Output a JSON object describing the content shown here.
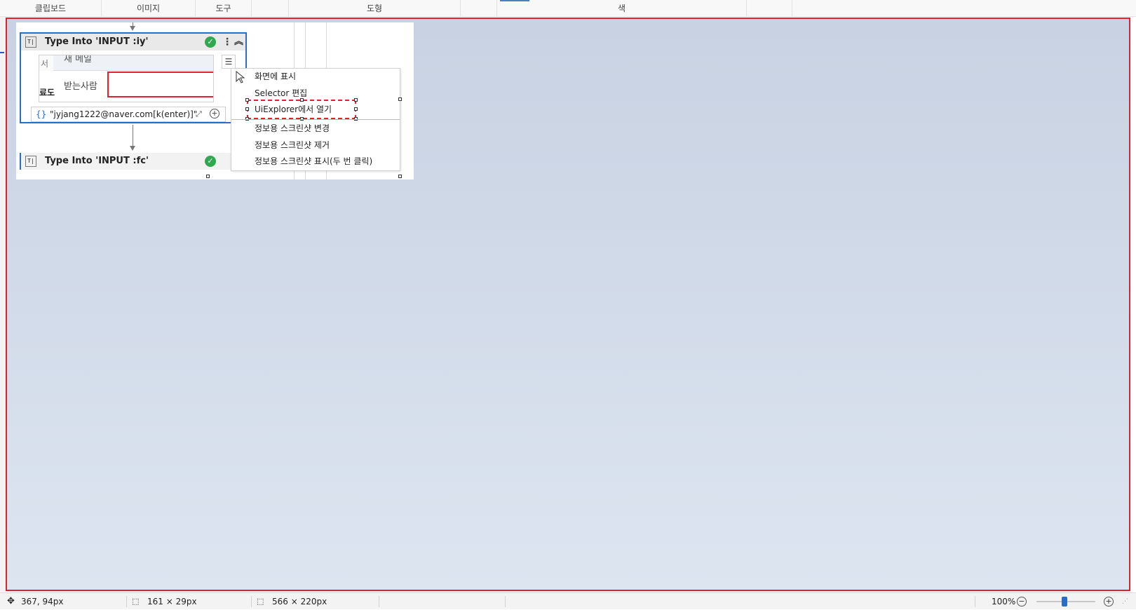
{
  "ribbon": {
    "groups": [
      {
        "label": "클립보드"
      },
      {
        "label": "이미지"
      },
      {
        "label": "도구"
      },
      {
        "label": "도형"
      },
      {
        "label": "색"
      }
    ]
  },
  "activities": {
    "first": {
      "title": "Type Into 'INPUT  :iy'",
      "preview": {
        "new_mail": "새 메일",
        "recipient_label": "받는사람",
        "left_text_top": "서",
        "left_text_bold": "료도"
      },
      "value": "\"jyjang1222@naver.com[k(enter)]\""
    },
    "second": {
      "title": "Type Into 'INPUT  :fc'"
    }
  },
  "context_menu": {
    "items": [
      {
        "label": "화면에 표시"
      },
      {
        "label": "Selector 편집"
      },
      {
        "label": "UiExplorer에서 열기"
      },
      {
        "label": "정보용 스크린샷 변경"
      },
      {
        "label": "정보용 스크린샷 제거"
      },
      {
        "label": "정보용 스크린샷 표시(두 번 클릭)"
      }
    ]
  },
  "icons": {
    "type_into": "type-into-icon",
    "success": "check-circle-icon",
    "more": "kebab-icon",
    "collapse": "chevron-up-icon",
    "cursor": "mouse-pointer-icon",
    "expand": "expand-icon",
    "add": "plus-circle-icon",
    "braces": "braces-icon"
  },
  "status_bar": {
    "cursor_pos": "367, 94px",
    "selection_size": "161 × 29px",
    "image_size": "566 × 220px",
    "zoom": "100%",
    "zoom_level_fraction": 0.5
  },
  "colors": {
    "selection_red": "#e0232b",
    "accent_blue": "#2b6cc4",
    "success_green": "#2fa84f"
  }
}
